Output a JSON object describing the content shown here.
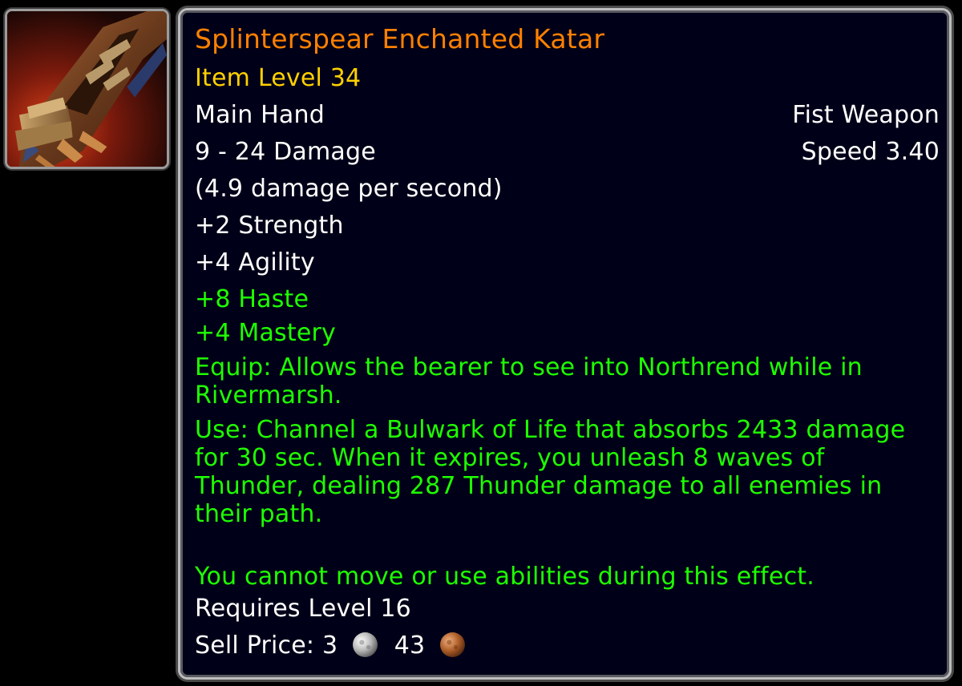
{
  "item": {
    "name": "Splinterspear Enchanted Katar",
    "item_level": "Item Level 34",
    "slot": "Main Hand",
    "type": "Fist Weapon",
    "damage": "9 - 24 Damage",
    "speed": "Speed 3.40",
    "dps": "(4.9 damage per second)",
    "stats": [
      "+2 Strength",
      "+4 Agility"
    ],
    "green_stats": [
      "+8 Haste",
      "+4 Mastery"
    ],
    "equip_text": "Equip: Allows the bearer to see into Northrend while in Rivermarsh.",
    "use_text": "Use: Channel a Bulwark of Life that absorbs 2433 damage for 30 sec. When it expires, you unleash 8 waves of Thunder, dealing 287 Thunder damage to all enemies in their path.",
    "use_note": "You cannot move or use abilities during this effect.",
    "requires": "Requires Level 16",
    "sell_label": "Sell Price:",
    "sell_silver": "3",
    "sell_copper": "43"
  },
  "icons": {
    "item_icon": "katar-icon",
    "silver": "silver-coin-icon",
    "copper": "copper-coin-icon"
  },
  "colors": {
    "legendary_name": "#ff8000",
    "item_level": "#ffd100",
    "green_text": "#1eff00",
    "white_text": "#ffffff",
    "tooltip_bg": "#000018"
  }
}
